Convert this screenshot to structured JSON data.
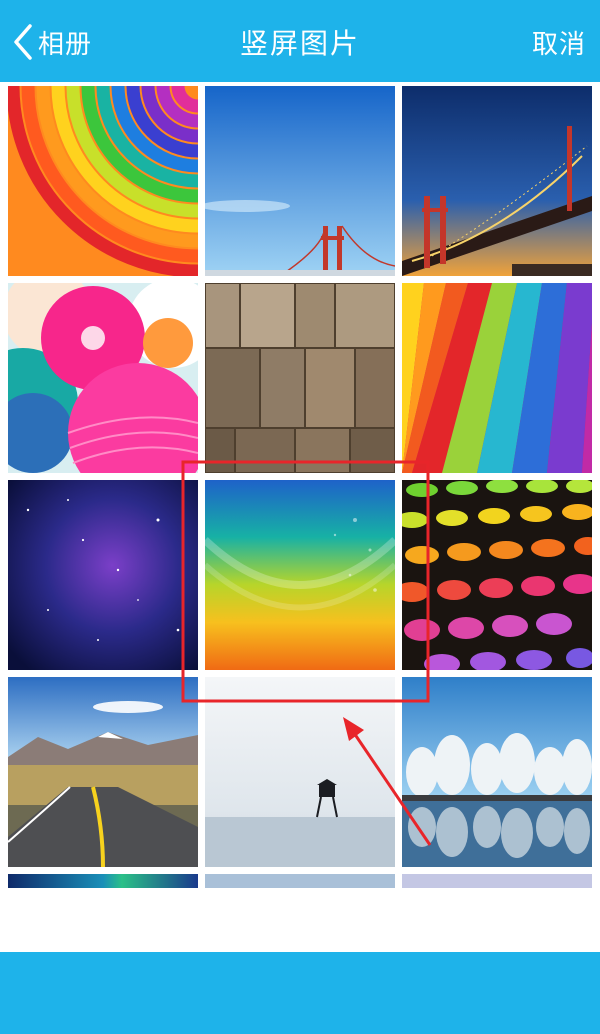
{
  "header": {
    "back_label": "相册",
    "title": "竖屏图片",
    "cancel_label": "取消"
  },
  "colors": {
    "accent": "#1eb3ea",
    "annotation": "#e8252a"
  },
  "wallpapers": [
    {
      "theme": "rainbow-curves"
    },
    {
      "theme": "golden-gate-blue-sky"
    },
    {
      "theme": "golden-gate-dusk"
    },
    {
      "theme": "paper-lanterns"
    },
    {
      "theme": "wood-shingles"
    },
    {
      "theme": "rainbow-rays"
    },
    {
      "theme": "galaxy"
    },
    {
      "theme": "rainbow-water-drops",
      "highlighted": true
    },
    {
      "theme": "colorful-dots"
    },
    {
      "theme": "mountain-road"
    },
    {
      "theme": "lifeguard-tower"
    },
    {
      "theme": "frosted-trees-lake"
    }
  ]
}
